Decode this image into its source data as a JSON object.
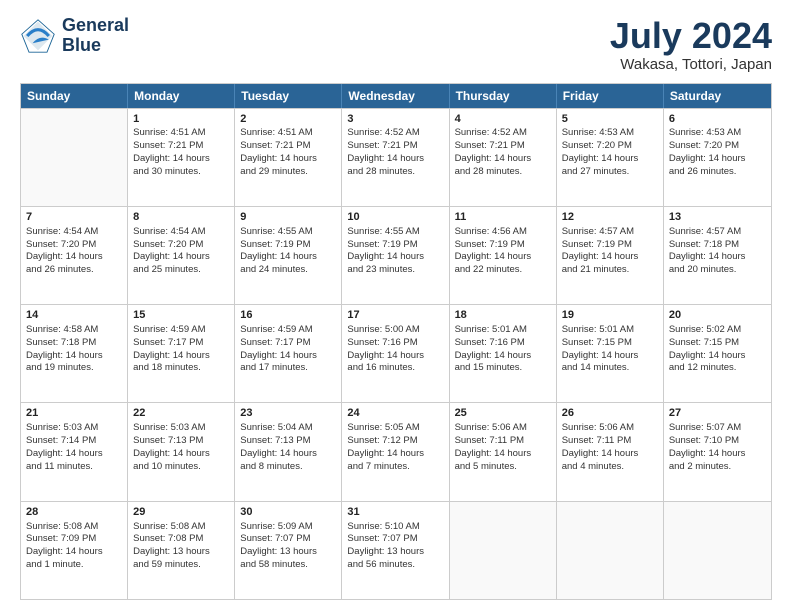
{
  "logo": {
    "line1": "General",
    "line2": "Blue"
  },
  "title": "July 2024",
  "subtitle": "Wakasa, Tottori, Japan",
  "days": [
    "Sunday",
    "Monday",
    "Tuesday",
    "Wednesday",
    "Thursday",
    "Friday",
    "Saturday"
  ],
  "weeks": [
    [
      {
        "day": "",
        "lines": []
      },
      {
        "day": "1",
        "lines": [
          "Sunrise: 4:51 AM",
          "Sunset: 7:21 PM",
          "Daylight: 14 hours",
          "and 30 minutes."
        ]
      },
      {
        "day": "2",
        "lines": [
          "Sunrise: 4:51 AM",
          "Sunset: 7:21 PM",
          "Daylight: 14 hours",
          "and 29 minutes."
        ]
      },
      {
        "day": "3",
        "lines": [
          "Sunrise: 4:52 AM",
          "Sunset: 7:21 PM",
          "Daylight: 14 hours",
          "and 28 minutes."
        ]
      },
      {
        "day": "4",
        "lines": [
          "Sunrise: 4:52 AM",
          "Sunset: 7:21 PM",
          "Daylight: 14 hours",
          "and 28 minutes."
        ]
      },
      {
        "day": "5",
        "lines": [
          "Sunrise: 4:53 AM",
          "Sunset: 7:20 PM",
          "Daylight: 14 hours",
          "and 27 minutes."
        ]
      },
      {
        "day": "6",
        "lines": [
          "Sunrise: 4:53 AM",
          "Sunset: 7:20 PM",
          "Daylight: 14 hours",
          "and 26 minutes."
        ]
      }
    ],
    [
      {
        "day": "7",
        "lines": [
          "Sunrise: 4:54 AM",
          "Sunset: 7:20 PM",
          "Daylight: 14 hours",
          "and 26 minutes."
        ]
      },
      {
        "day": "8",
        "lines": [
          "Sunrise: 4:54 AM",
          "Sunset: 7:20 PM",
          "Daylight: 14 hours",
          "and 25 minutes."
        ]
      },
      {
        "day": "9",
        "lines": [
          "Sunrise: 4:55 AM",
          "Sunset: 7:19 PM",
          "Daylight: 14 hours",
          "and 24 minutes."
        ]
      },
      {
        "day": "10",
        "lines": [
          "Sunrise: 4:55 AM",
          "Sunset: 7:19 PM",
          "Daylight: 14 hours",
          "and 23 minutes."
        ]
      },
      {
        "day": "11",
        "lines": [
          "Sunrise: 4:56 AM",
          "Sunset: 7:19 PM",
          "Daylight: 14 hours",
          "and 22 minutes."
        ]
      },
      {
        "day": "12",
        "lines": [
          "Sunrise: 4:57 AM",
          "Sunset: 7:19 PM",
          "Daylight: 14 hours",
          "and 21 minutes."
        ]
      },
      {
        "day": "13",
        "lines": [
          "Sunrise: 4:57 AM",
          "Sunset: 7:18 PM",
          "Daylight: 14 hours",
          "and 20 minutes."
        ]
      }
    ],
    [
      {
        "day": "14",
        "lines": [
          "Sunrise: 4:58 AM",
          "Sunset: 7:18 PM",
          "Daylight: 14 hours",
          "and 19 minutes."
        ]
      },
      {
        "day": "15",
        "lines": [
          "Sunrise: 4:59 AM",
          "Sunset: 7:17 PM",
          "Daylight: 14 hours",
          "and 18 minutes."
        ]
      },
      {
        "day": "16",
        "lines": [
          "Sunrise: 4:59 AM",
          "Sunset: 7:17 PM",
          "Daylight: 14 hours",
          "and 17 minutes."
        ]
      },
      {
        "day": "17",
        "lines": [
          "Sunrise: 5:00 AM",
          "Sunset: 7:16 PM",
          "Daylight: 14 hours",
          "and 16 minutes."
        ]
      },
      {
        "day": "18",
        "lines": [
          "Sunrise: 5:01 AM",
          "Sunset: 7:16 PM",
          "Daylight: 14 hours",
          "and 15 minutes."
        ]
      },
      {
        "day": "19",
        "lines": [
          "Sunrise: 5:01 AM",
          "Sunset: 7:15 PM",
          "Daylight: 14 hours",
          "and 14 minutes."
        ]
      },
      {
        "day": "20",
        "lines": [
          "Sunrise: 5:02 AM",
          "Sunset: 7:15 PM",
          "Daylight: 14 hours",
          "and 12 minutes."
        ]
      }
    ],
    [
      {
        "day": "21",
        "lines": [
          "Sunrise: 5:03 AM",
          "Sunset: 7:14 PM",
          "Daylight: 14 hours",
          "and 11 minutes."
        ]
      },
      {
        "day": "22",
        "lines": [
          "Sunrise: 5:03 AM",
          "Sunset: 7:13 PM",
          "Daylight: 14 hours",
          "and 10 minutes."
        ]
      },
      {
        "day": "23",
        "lines": [
          "Sunrise: 5:04 AM",
          "Sunset: 7:13 PM",
          "Daylight: 14 hours",
          "and 8 minutes."
        ]
      },
      {
        "day": "24",
        "lines": [
          "Sunrise: 5:05 AM",
          "Sunset: 7:12 PM",
          "Daylight: 14 hours",
          "and 7 minutes."
        ]
      },
      {
        "day": "25",
        "lines": [
          "Sunrise: 5:06 AM",
          "Sunset: 7:11 PM",
          "Daylight: 14 hours",
          "and 5 minutes."
        ]
      },
      {
        "day": "26",
        "lines": [
          "Sunrise: 5:06 AM",
          "Sunset: 7:11 PM",
          "Daylight: 14 hours",
          "and 4 minutes."
        ]
      },
      {
        "day": "27",
        "lines": [
          "Sunrise: 5:07 AM",
          "Sunset: 7:10 PM",
          "Daylight: 14 hours",
          "and 2 minutes."
        ]
      }
    ],
    [
      {
        "day": "28",
        "lines": [
          "Sunrise: 5:08 AM",
          "Sunset: 7:09 PM",
          "Daylight: 14 hours",
          "and 1 minute."
        ]
      },
      {
        "day": "29",
        "lines": [
          "Sunrise: 5:08 AM",
          "Sunset: 7:08 PM",
          "Daylight: 13 hours",
          "and 59 minutes."
        ]
      },
      {
        "day": "30",
        "lines": [
          "Sunrise: 5:09 AM",
          "Sunset: 7:07 PM",
          "Daylight: 13 hours",
          "and 58 minutes."
        ]
      },
      {
        "day": "31",
        "lines": [
          "Sunrise: 5:10 AM",
          "Sunset: 7:07 PM",
          "Daylight: 13 hours",
          "and 56 minutes."
        ]
      },
      {
        "day": "",
        "lines": []
      },
      {
        "day": "",
        "lines": []
      },
      {
        "day": "",
        "lines": []
      }
    ]
  ]
}
